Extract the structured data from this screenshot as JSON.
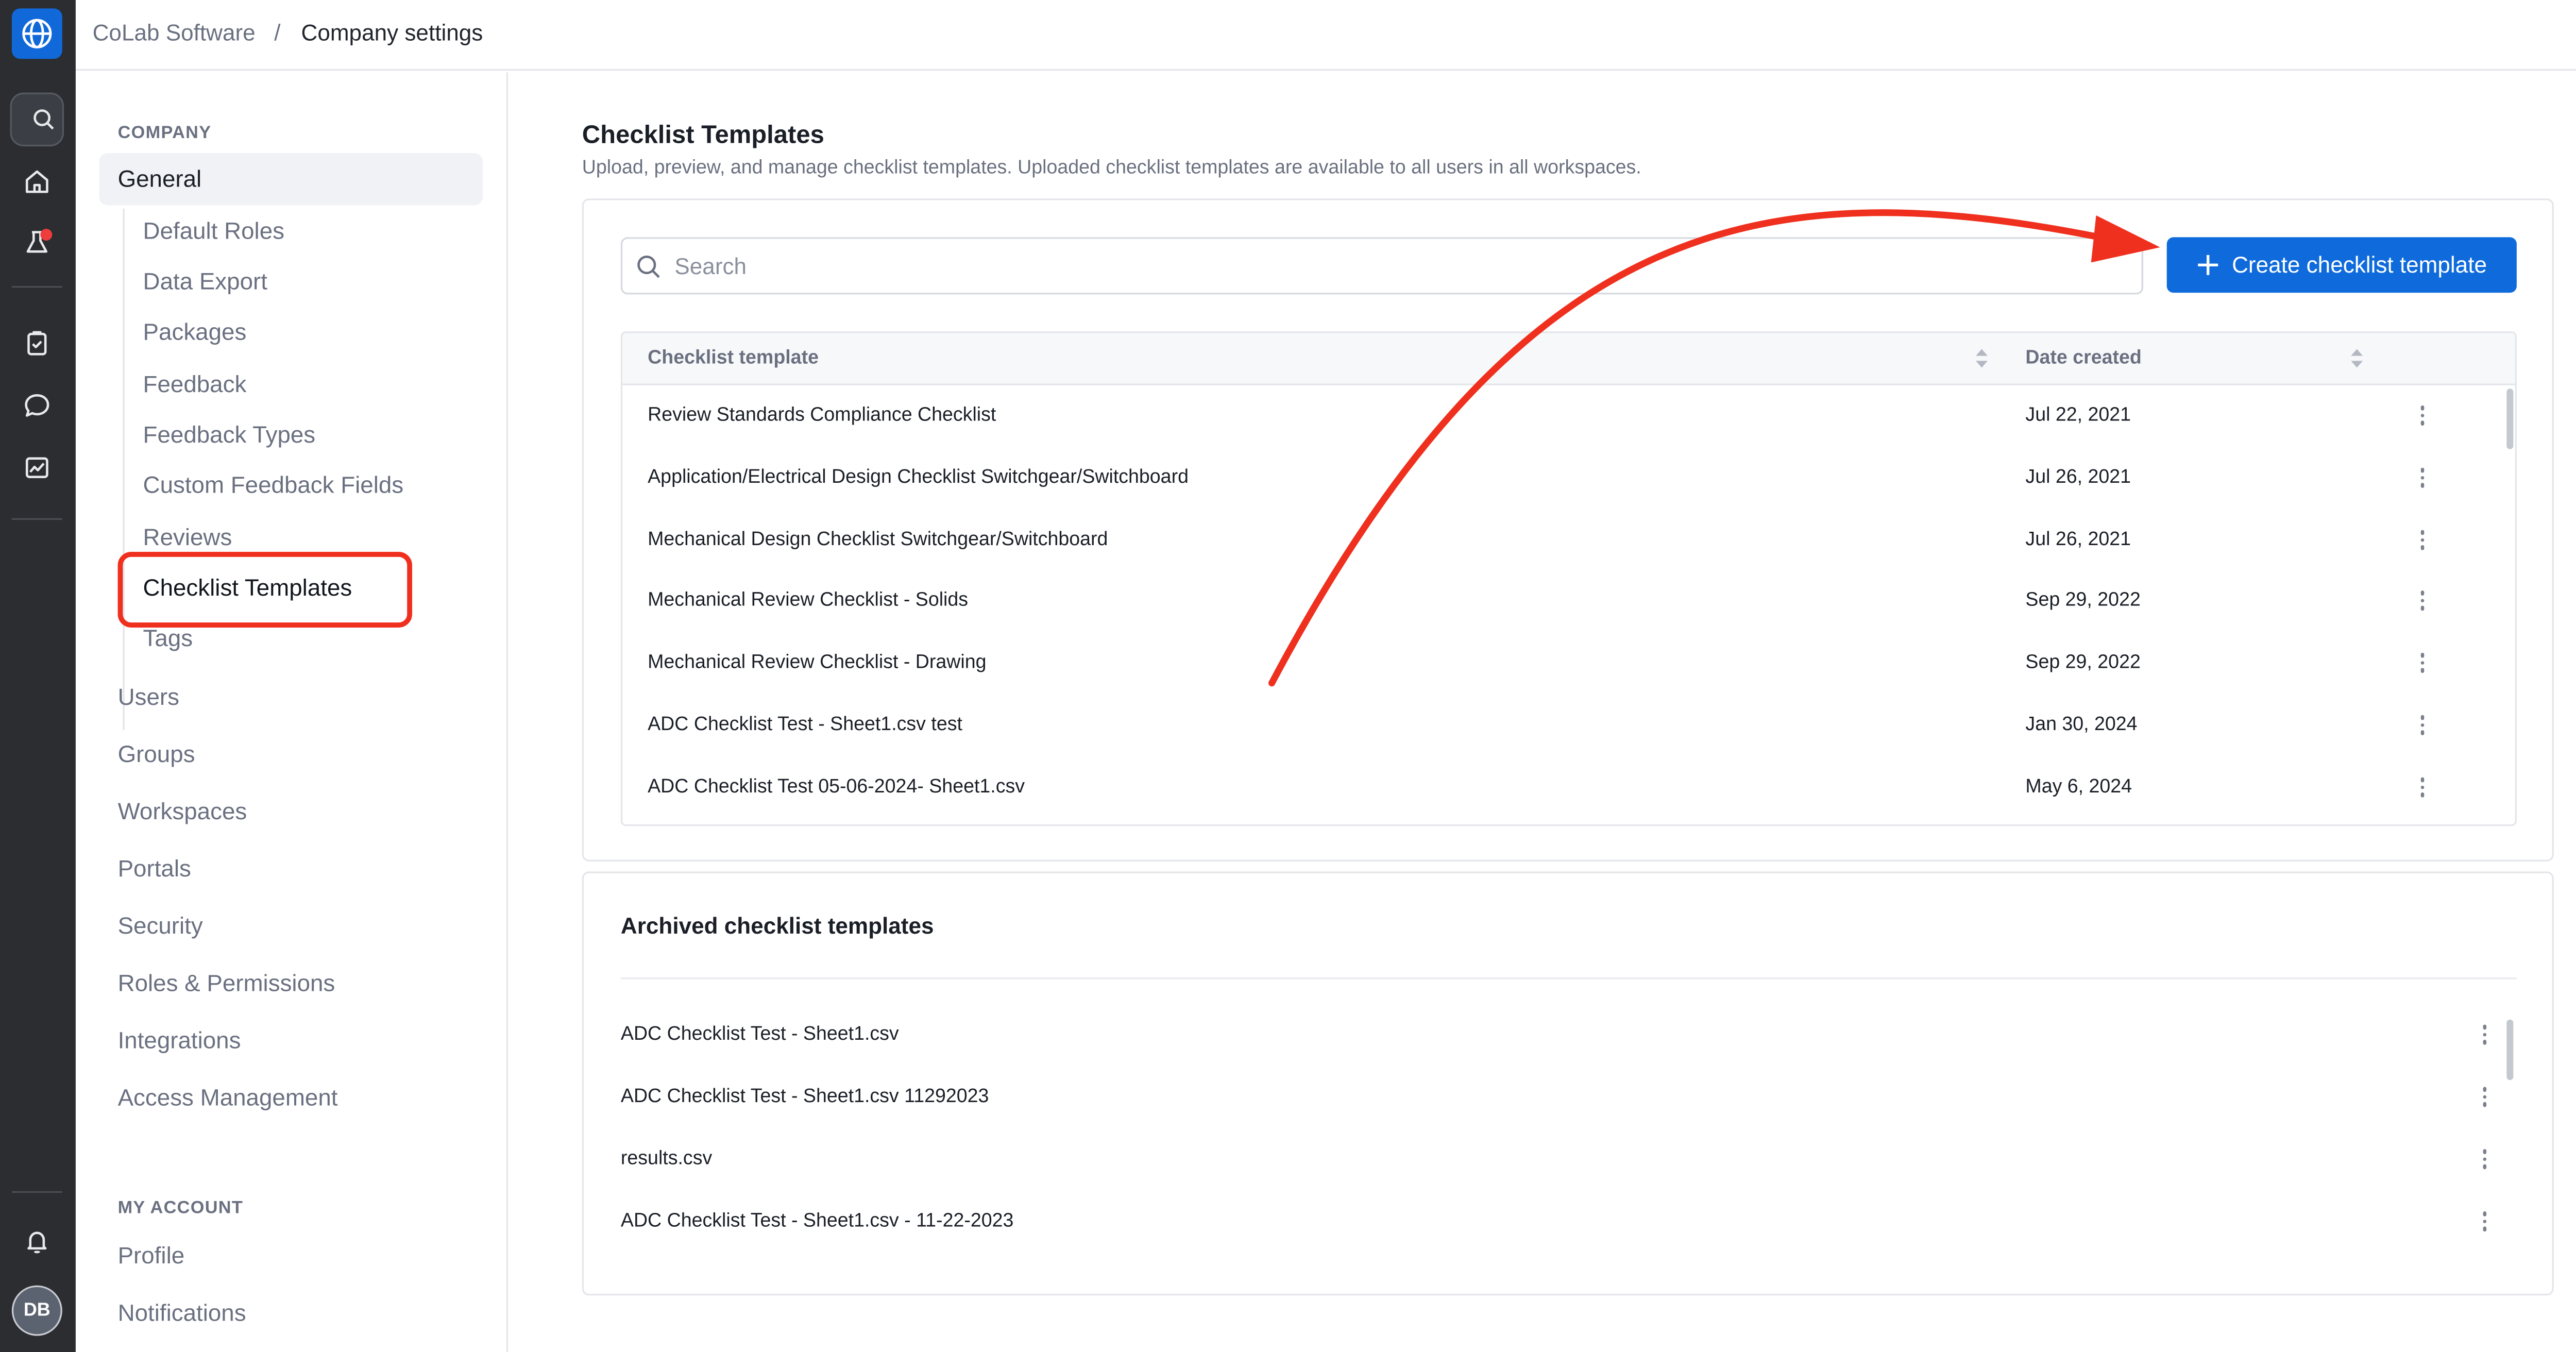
{
  "app": {
    "org_name": "CoLab Software",
    "breadcrumb_separator": "/",
    "page_name": "Company settings",
    "user_initials": "DB"
  },
  "rail": {
    "icons": [
      "globe-logo-icon",
      "search-icon",
      "home-icon",
      "flask-icon",
      "clipboard-check-icon",
      "chat-bubble-icon",
      "chart-image-icon",
      "bell-icon"
    ]
  },
  "sidebar": {
    "company_heading": "COMPANY",
    "general_label": "General",
    "general_items": [
      {
        "label": "Default Roles"
      },
      {
        "label": "Data Export"
      },
      {
        "label": "Packages"
      },
      {
        "label": "Feedback"
      },
      {
        "label": "Feedback Types"
      },
      {
        "label": "Custom Feedback Fields"
      },
      {
        "label": "Reviews"
      },
      {
        "label": "Checklist Templates",
        "active": true
      },
      {
        "label": "Tags"
      }
    ],
    "top_items": [
      {
        "label": "Users"
      },
      {
        "label": "Groups"
      },
      {
        "label": "Workspaces"
      },
      {
        "label": "Portals"
      },
      {
        "label": "Security"
      },
      {
        "label": "Roles & Permissions"
      },
      {
        "label": "Integrations"
      },
      {
        "label": "Access Management"
      }
    ],
    "account_heading": "MY ACCOUNT",
    "account_items": [
      {
        "label": "Profile"
      },
      {
        "label": "Notifications"
      }
    ]
  },
  "main": {
    "title": "Checklist Templates",
    "description": "Upload, preview, and manage checklist templates. Uploaded checklist templates are available to all users in all workspaces.",
    "search_placeholder": "Search",
    "create_button_label": "Create checklist template",
    "table": {
      "col_template": "Checklist template",
      "col_date": "Date created",
      "rows": [
        {
          "name": "Review Standards Compliance Checklist",
          "date": "Jul 22, 2021"
        },
        {
          "name": "Application/Electrical Design Checklist Switchgear/Switchboard",
          "date": "Jul 26, 2021"
        },
        {
          "name": "Mechanical Design Checklist Switchgear/Switchboard",
          "date": "Jul 26, 2021"
        },
        {
          "name": "Mechanical Review Checklist - Solids",
          "date": "Sep 29, 2022"
        },
        {
          "name": "Mechanical Review Checklist - Drawing",
          "date": "Sep 29, 2022"
        },
        {
          "name": "ADC Checklist Test - Sheet1.csv test",
          "date": "Jan 30, 2024"
        },
        {
          "name": "ADC Checklist Test 05-06-2024- Sheet1.csv",
          "date": "May 6, 2024"
        }
      ]
    },
    "archived": {
      "title": "Archived checklist templates",
      "rows": [
        {
          "name": "ADC Checklist Test - Sheet1.csv"
        },
        {
          "name": "ADC Checklist Test - Sheet1.csv 11292023"
        },
        {
          "name": "results.csv"
        },
        {
          "name": "ADC Checklist Test - Sheet1.csv - 11-22-2023"
        }
      ]
    }
  },
  "colors": {
    "accent": "#0f6bdc",
    "rail_bg": "#2b2d31",
    "annotation_red": "#f0301e",
    "notification_dot": "#ef3d3d"
  }
}
